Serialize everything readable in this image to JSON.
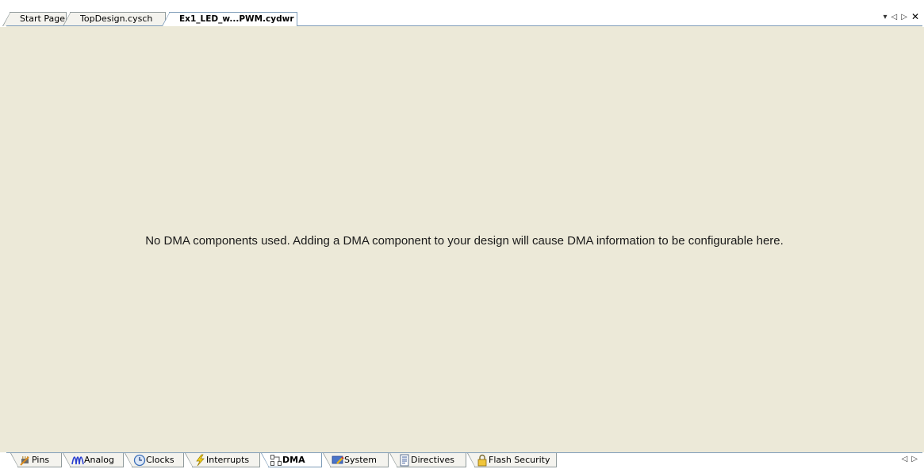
{
  "doc_tabs": [
    {
      "label": "Start Page",
      "active": false
    },
    {
      "label": "TopDesign.cysch",
      "active": false
    },
    {
      "label": "Ex1_LED_w...PWM.cydwr",
      "active": true
    }
  ],
  "window_controls": {
    "dropdown": "▾",
    "scroll_left": "◁",
    "scroll_right": "▷",
    "close": "✕"
  },
  "content": {
    "message": "No DMA components used. Adding a DMA component to your design will cause DMA information to be configurable here."
  },
  "page_tabs": [
    {
      "label": "Pins",
      "icon": "pins-icon",
      "active": false
    },
    {
      "label": "Analog",
      "icon": "analog-wave-icon",
      "active": false
    },
    {
      "label": "Clocks",
      "icon": "clock-icon",
      "active": false
    },
    {
      "label": "Interrupts",
      "icon": "lightning-icon",
      "active": false
    },
    {
      "label": "DMA",
      "icon": "dma-icon",
      "active": true
    },
    {
      "label": "System",
      "icon": "system-icon",
      "active": false
    },
    {
      "label": "Directives",
      "icon": "directives-icon",
      "active": false
    },
    {
      "label": "Flash Security",
      "icon": "lock-icon",
      "active": false
    }
  ],
  "bottom_scroll": {
    "left": "◁",
    "right": "▷"
  },
  "colors": {
    "background": "#ece9d8",
    "tab_border": "#7f9db9",
    "inactive_tab": "#f4f3ee"
  }
}
